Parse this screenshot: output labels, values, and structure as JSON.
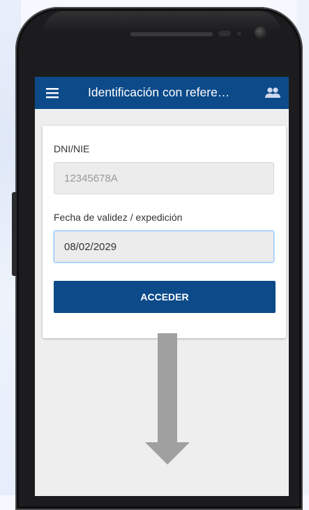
{
  "app_bar": {
    "title": "Identificación con refere…",
    "menu_icon": "hamburger-menu-icon",
    "people_icon": "people-icon",
    "color": "#0c4a8a"
  },
  "form": {
    "dni_label": "DNI/NIE",
    "dni_value": "12345678A",
    "date_label": "Fecha de validez / expedición",
    "date_value": "08/02/2029",
    "submit_label": "ACCEDER"
  },
  "overlay": {
    "arrow_icon": "down-arrow-icon",
    "arrow_color": "#a0a0a0"
  }
}
